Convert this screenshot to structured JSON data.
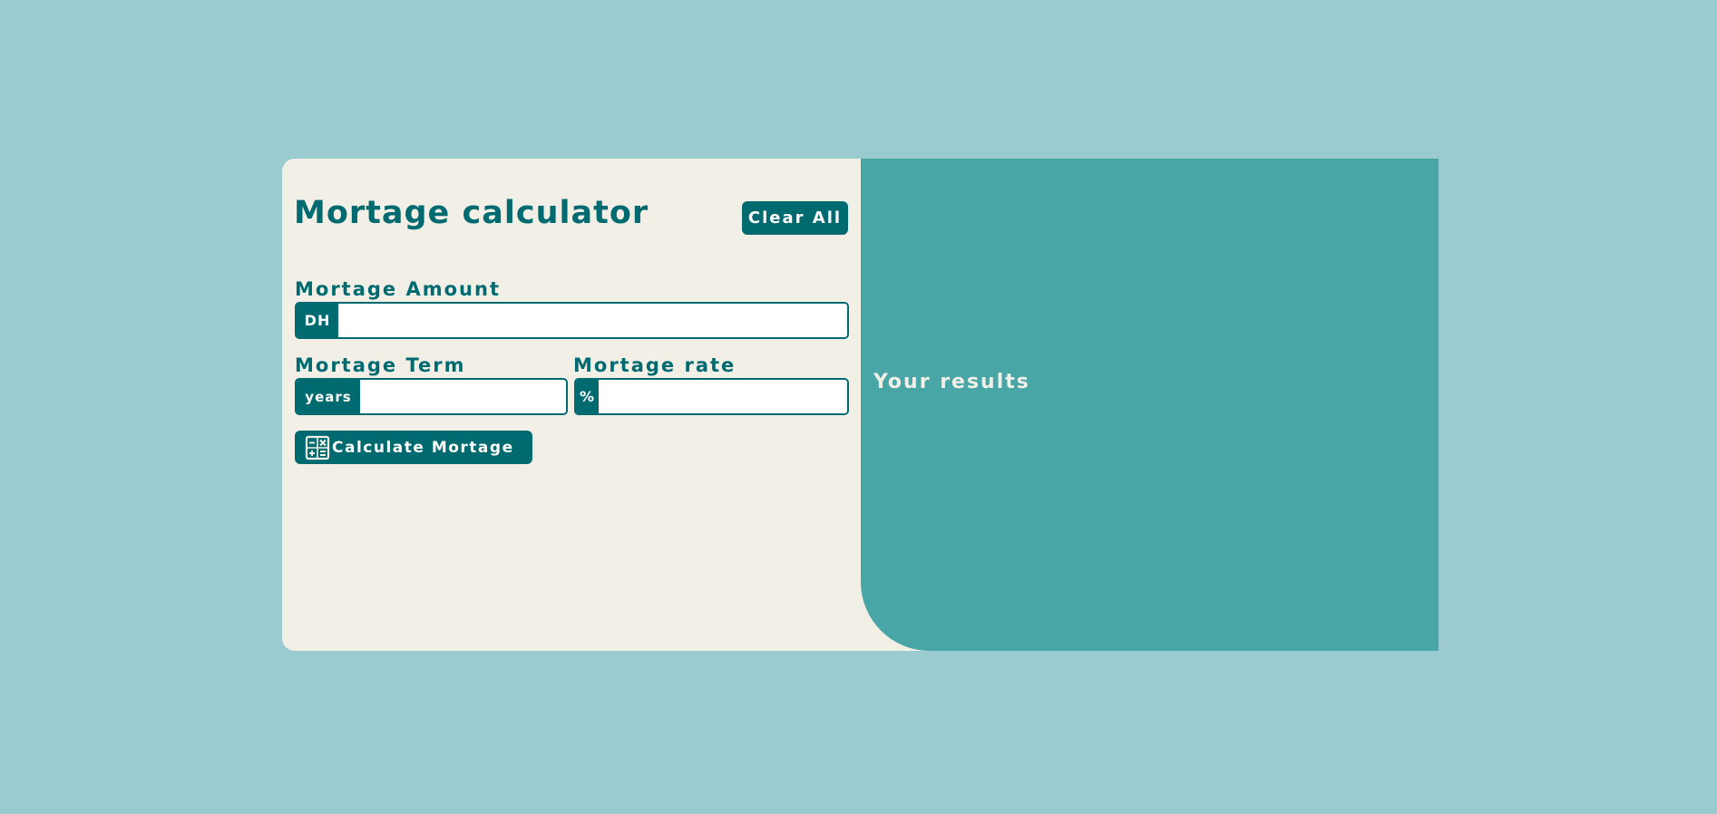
{
  "calculator": {
    "title": "Mortage calculator",
    "clear_label": "Clear All",
    "amount": {
      "label": "Mortage Amount",
      "prefix": "DH",
      "value": "",
      "placeholder": ""
    },
    "term": {
      "label": "Mortage Term",
      "prefix": "years",
      "value": "",
      "placeholder": ""
    },
    "rate": {
      "label": "Mortage rate",
      "prefix": "%",
      "value": "",
      "placeholder": ""
    },
    "calculate_label": "Calculate Mortage",
    "calculate_icon": "calculator-icon"
  },
  "results": {
    "title": "Your results"
  },
  "colors": {
    "page_background": "#9acbd0",
    "form_background": "#f2efe7",
    "accent": "#006a71",
    "results_background": "#48a6a7",
    "results_text": "#f2efe7"
  }
}
